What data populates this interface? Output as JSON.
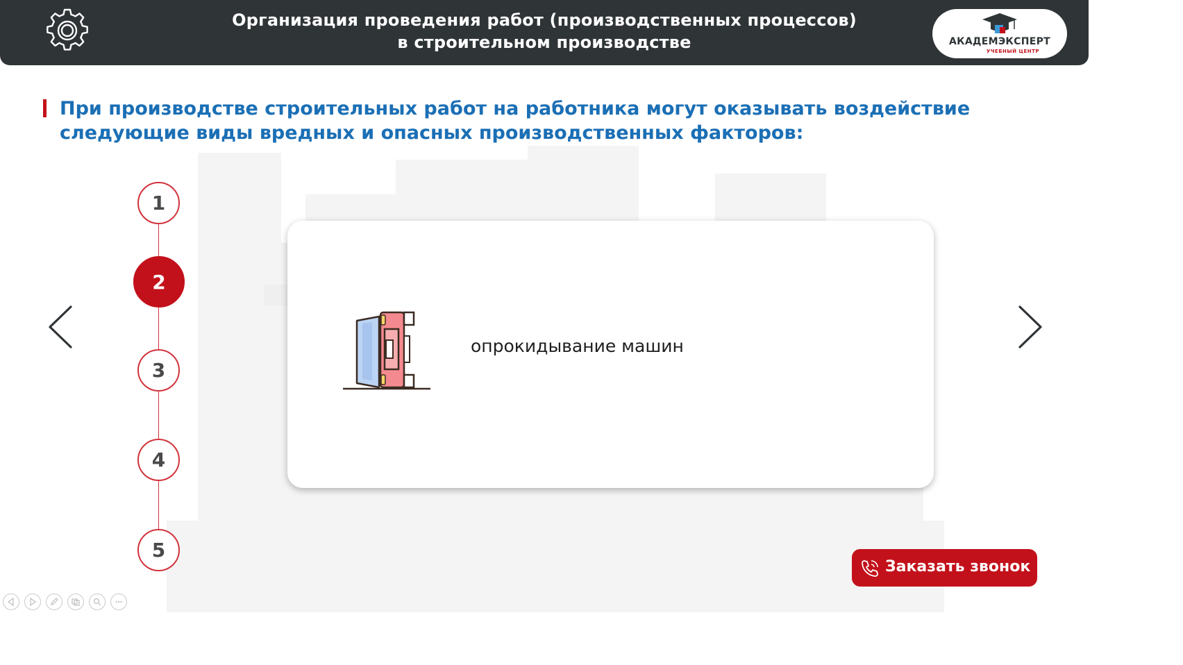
{
  "header": {
    "title_line1": "Организация проведения работ (производственных процессов)",
    "title_line2": "в строительном производстве",
    "icon": "gear-icon"
  },
  "logo": {
    "name": "АКАДЕМЭКСПЕРТ",
    "subtitle": "УЧЕБНЫЙ ЦЕНТР",
    "icon": "graduation-cap-icon"
  },
  "heading": {
    "line1": "При производстве строительных работ на работника могут оказывать воздействие",
    "line2": "следующие виды вредных и опасных производственных факторов:"
  },
  "steps": [
    {
      "label": "1",
      "active": false
    },
    {
      "label": "2",
      "active": true
    },
    {
      "label": "3",
      "active": false
    },
    {
      "label": "4",
      "active": false
    },
    {
      "label": "5",
      "active": false
    }
  ],
  "navigation": {
    "prev_icon": "chevron-left-icon",
    "next_icon": "chevron-right-icon"
  },
  "card": {
    "icon": "overturned-car-icon",
    "text": "опрокидывание машин"
  },
  "call_button": {
    "label": "Заказать звонок",
    "icon": "phone-icon"
  },
  "player_controls": [
    "prev-slide-icon",
    "next-slide-icon",
    "pen-icon",
    "slides-icon",
    "zoom-icon",
    "more-icon"
  ],
  "colors": {
    "header_bg": "#2f3437",
    "accent_red": "#c3111b",
    "heading_blue": "#1b6fb5",
    "text_dark": "#1e1e1e"
  }
}
